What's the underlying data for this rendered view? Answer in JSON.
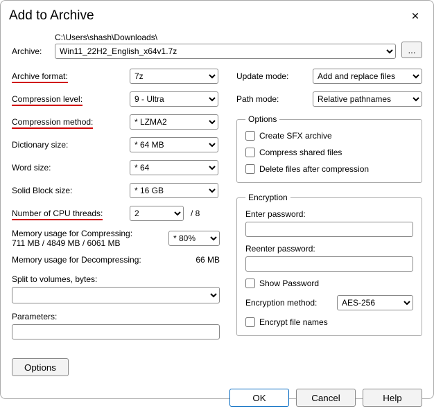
{
  "window": {
    "title": "Add to Archive",
    "close": "✕"
  },
  "archive": {
    "label": "Archive:",
    "path": "C:\\Users\\shash\\Downloads\\",
    "filename": "Win11_22H2_English_x64v1.7z",
    "browse": "..."
  },
  "left": {
    "format": {
      "label": "Archive format:",
      "value": "7z"
    },
    "level": {
      "label": "Compression level:",
      "value": "9 - Ultra"
    },
    "method": {
      "label": "Compression method:",
      "value": "* LZMA2"
    },
    "dict": {
      "label": "Dictionary size:",
      "value": "* 64 MB"
    },
    "word": {
      "label": "Word size:",
      "value": "* 64"
    },
    "solid": {
      "label": "Solid Block size:",
      "value": "* 16 GB"
    },
    "threads": {
      "label": "Number of CPU threads:",
      "value": "2",
      "suffix": "/ 8"
    },
    "mem_compress": {
      "label": "Memory usage for Compressing:",
      "detail": "711 MB / 4849 MB / 6061 MB",
      "pct": "* 80%"
    },
    "mem_decompress": {
      "label": "Memory usage for Decompressing:",
      "value": "66 MB"
    },
    "split": {
      "label": "Split to volumes, bytes:",
      "value": ""
    },
    "params": {
      "label": "Parameters:",
      "value": ""
    }
  },
  "right": {
    "update": {
      "label": "Update mode:",
      "value": "Add and replace files"
    },
    "pathmode": {
      "label": "Path mode:",
      "value": "Relative pathnames"
    },
    "options": {
      "legend": "Options",
      "sfx": "Create SFX archive",
      "shared": "Compress shared files",
      "delete": "Delete files after compression"
    },
    "encryption": {
      "legend": "Encryption",
      "enter": "Enter password:",
      "reenter": "Reenter password:",
      "show": "Show Password",
      "method_label": "Encryption method:",
      "method_value": "AES-256",
      "encrypt_names": "Encrypt file names"
    }
  },
  "buttons": {
    "options": "Options",
    "ok": "OK",
    "cancel": "Cancel",
    "help": "Help"
  }
}
